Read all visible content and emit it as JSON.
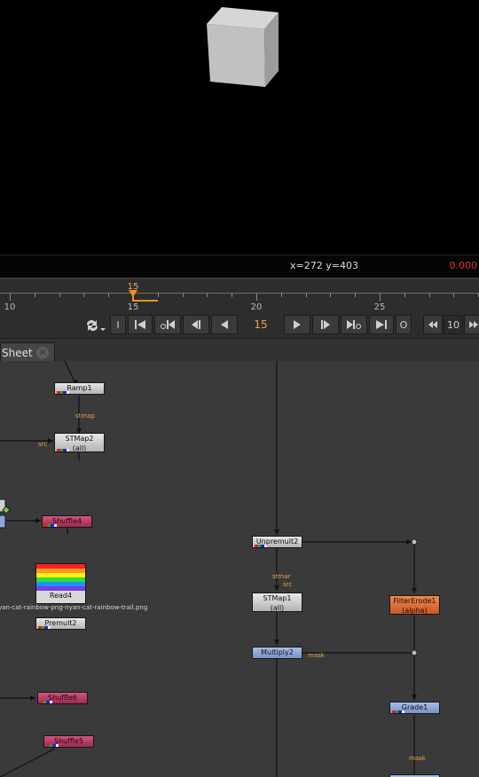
{
  "viewer": {
    "coords": "x=272 y=403",
    "value": "0.000"
  },
  "timeline": {
    "current_frame": "15",
    "tick_labels": [
      "10",
      "15",
      "20",
      "25"
    ]
  },
  "transport": {
    "in_label": "I",
    "out_label": "O",
    "frame": "15",
    "increment": "10"
  },
  "tab": {
    "label": "Sheet",
    "close": "×"
  },
  "graph": {
    "nodes": {
      "ramp1": "Ramp1",
      "stmap2": "STMap2",
      "stmap2_sub": "(all)",
      "shuffle4": "Shuffle4",
      "read4": "Read4",
      "read4_file": "yan-cat-rainbow-png-nyan-cat-rainbow-trail.png",
      "premult2": "Premult2",
      "shuffle6": "Shuffle6",
      "shuffle5": "Shuffle5",
      "unpremult2": "Unpremult2",
      "stmap1": "STMap1",
      "stmap1_sub": "(all)",
      "multiply2": "Multiply2",
      "filtererode1": "FilterErode1",
      "filtererode1_sub": "(alpha)",
      "grade1": "Grade1"
    },
    "wire_labels": {
      "stmap_a": "stmap",
      "src_a": "src",
      "stmap_b": "stmar",
      "src_b": "src",
      "mask_a": "mask",
      "mask_b": "mask"
    }
  },
  "colors": {
    "accent": "#f09020",
    "value_red": "#e03030",
    "node_pink": "#b8406a",
    "node_blue": "#8fa8d8",
    "node_orange": "#e07038",
    "graph_bg": "#3a3a3a"
  }
}
